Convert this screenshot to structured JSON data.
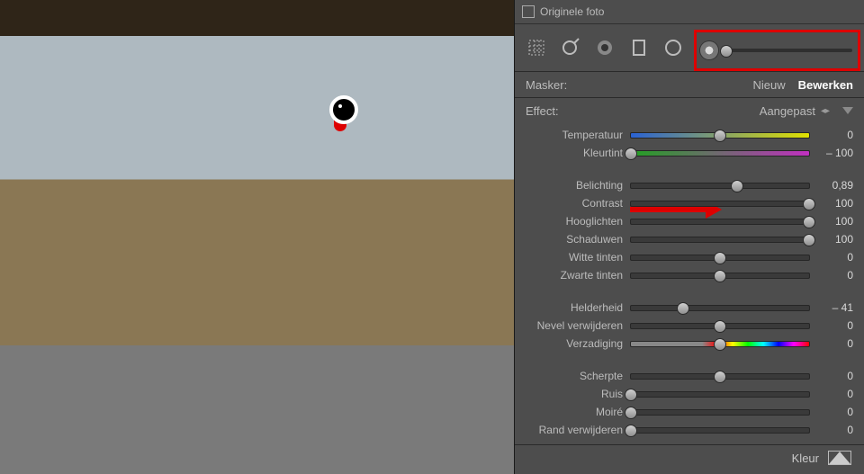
{
  "header": {
    "originele_foto": "Originele foto"
  },
  "mask": {
    "label": "Masker:",
    "new": "Nieuw",
    "edit": "Bewerken"
  },
  "effect": {
    "label": "Effect:",
    "value": "Aangepast"
  },
  "sliders": {
    "temperatuur": {
      "label": "Temperatuur",
      "value": "0",
      "pos": 0.5
    },
    "kleurtint": {
      "label": "Kleurtint",
      "value": "– 100",
      "pos": 0.0
    },
    "belichting": {
      "label": "Belichting",
      "value": "0,89",
      "pos": 0.595
    },
    "contrast": {
      "label": "Contrast",
      "value": "100",
      "pos": 1.0
    },
    "hooglichten": {
      "label": "Hooglichten",
      "value": "100",
      "pos": 1.0
    },
    "schaduwen": {
      "label": "Schaduwen",
      "value": "100",
      "pos": 1.0
    },
    "witte": {
      "label": "Witte tinten",
      "value": "0",
      "pos": 0.5
    },
    "zwarte": {
      "label": "Zwarte tinten",
      "value": "0",
      "pos": 0.5
    },
    "helderheid": {
      "label": "Helderheid",
      "value": "– 41",
      "pos": 0.295
    },
    "nevel": {
      "label": "Nevel verwijderen",
      "value": "0",
      "pos": 0.5
    },
    "verzadiging": {
      "label": "Verzadiging",
      "value": "0",
      "pos": 0.5
    },
    "scherpte": {
      "label": "Scherpte",
      "value": "0",
      "pos": 0.5
    },
    "ruis": {
      "label": "Ruis",
      "value": "0",
      "pos": 0.0
    },
    "moire": {
      "label": "Moiré",
      "value": "0",
      "pos": 0.0
    },
    "rand": {
      "label": "Rand verwijderen",
      "value": "0",
      "pos": 0.0
    }
  },
  "kleur": {
    "label": "Kleur"
  },
  "toolbar": {
    "feather_pos": 0.02
  },
  "chart_data": {
    "type": "table",
    "title": "Lightroom local adjustment slider values",
    "data": [
      {
        "param": "Temperatuur",
        "value": 0
      },
      {
        "param": "Kleurtint",
        "value": -100
      },
      {
        "param": "Belichting",
        "value": 0.89
      },
      {
        "param": "Contrast",
        "value": 100
      },
      {
        "param": "Hooglichten",
        "value": 100
      },
      {
        "param": "Schaduwen",
        "value": 100
      },
      {
        "param": "Witte tinten",
        "value": 0
      },
      {
        "param": "Zwarte tinten",
        "value": 0
      },
      {
        "param": "Helderheid",
        "value": -41
      },
      {
        "param": "Nevel verwijderen",
        "value": 0
      },
      {
        "param": "Verzadiging",
        "value": 0
      },
      {
        "param": "Scherpte",
        "value": 0
      },
      {
        "param": "Ruis",
        "value": 0
      },
      {
        "param": "Moiré",
        "value": 0
      },
      {
        "param": "Rand verwijderen",
        "value": 0
      }
    ]
  }
}
